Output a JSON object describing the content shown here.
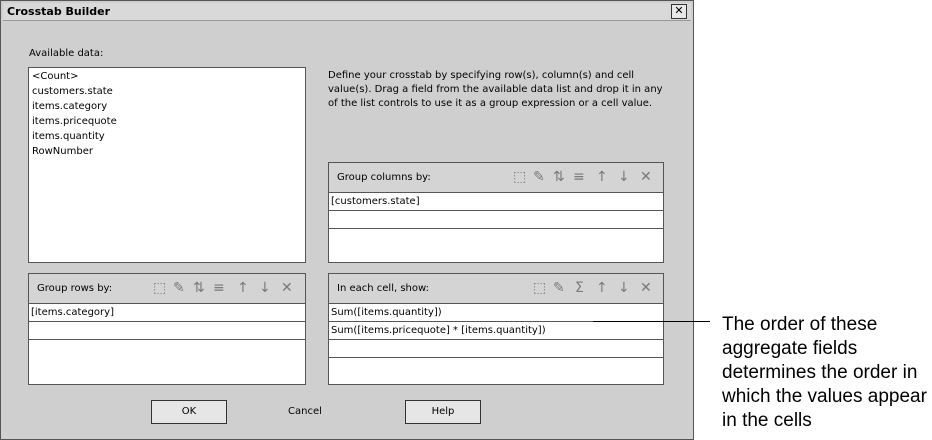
{
  "dialog": {
    "title": "Crosstab Builder",
    "close_glyph": "✕",
    "available_label": "Available data:",
    "available_items": [
      "<Count>",
      "customers.state",
      "items.category",
      "items.pricequote",
      "items.quantity",
      "RowNumber"
    ],
    "description": "Define your crosstab by specifying row(s), column(s) and cell value(s). Drag a field from the available data list and drop it in any of the list controls to use it as a group expression or a cell value."
  },
  "group_columns": {
    "label": "Group columns by:",
    "rows": [
      "[customers.state]",
      "",
      ""
    ]
  },
  "group_rows": {
    "label": "Group rows by:",
    "rows": [
      "[items.category]",
      "",
      ""
    ]
  },
  "cells": {
    "label": "In each cell, show:",
    "rows": [
      "Sum([items.quantity])",
      "Sum([items.pricequote] * [items.quantity])",
      "",
      ""
    ]
  },
  "toolbar_icons": {
    "new": "⬚",
    "edit": "✎",
    "sort": "⇅",
    "align": "≡",
    "up": "↑",
    "down": "↓",
    "delete": "✕",
    "sum": "Σ"
  },
  "buttons": {
    "ok": "OK",
    "cancel": "Cancel",
    "help": "Help"
  },
  "callout": {
    "text": "The order of these aggregate fields determines the order in which the values appear in the cells"
  }
}
